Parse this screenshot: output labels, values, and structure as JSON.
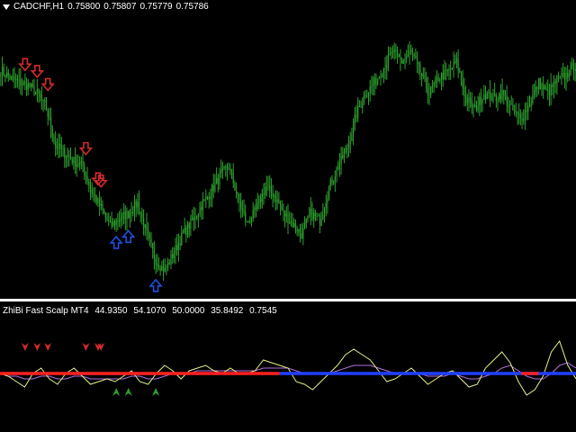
{
  "main_chart": {
    "symbol_tf": "CADCHF,H1",
    "open": "0.75800",
    "high": "0.75807",
    "low": "0.75779",
    "close": "0.75786",
    "candle_color": "#2ea12e",
    "sell_arrow_color": "#d42a2a",
    "buy_arrow_color": "#1f4fe0"
  },
  "indicator": {
    "name": "ZhiBi Fast Scalp MT4",
    "v1": "44.9350",
    "v2": "54.1070",
    "v3": "50.0000",
    "v4": "35.8492",
    "v5": "0.7545",
    "sell_line_color": "#ff2020",
    "buy_line_color": "#2040ff",
    "fast_line_color": "#e6f08a",
    "slow_line_color": "#b070e0"
  },
  "chart_data": {
    "type": "line",
    "series": [
      {
        "values": [
          0.7585,
          0.7582,
          0.758,
          0.7579,
          0.7576,
          0.757,
          0.7556,
          0.7553,
          0.755,
          0.7548,
          0.7538,
          0.7532,
          0.7525,
          0.7528,
          0.753,
          0.7534,
          0.7522,
          0.7512,
          0.7508,
          0.7515,
          0.7522,
          0.7527,
          0.7533,
          0.7538,
          0.7544,
          0.7548,
          0.7536,
          0.7526,
          0.7531,
          0.754,
          0.7537,
          0.753,
          0.7526,
          0.7522,
          0.753,
          0.7527,
          0.754,
          0.7548,
          0.7555,
          0.7568,
          0.7576,
          0.758,
          0.7586,
          0.7592,
          0.7588,
          0.7592,
          0.7584,
          0.7576,
          0.7582,
          0.7584,
          0.7588,
          0.7574,
          0.757,
          0.7576,
          0.7574,
          0.7576,
          0.757,
          0.7566,
          0.7572,
          0.758,
          0.7576,
          0.7581,
          0.7583,
          0.7587
        ]
      }
    ],
    "sell_arrows": [
      16,
      24,
      31,
      56,
      64,
      66
    ],
    "buy_arrows": [
      76,
      84,
      102
    ],
    "indicator_fast": [
      50,
      49,
      47,
      45,
      50,
      52,
      48,
      46,
      50,
      52,
      49,
      46,
      47,
      48,
      47,
      49,
      51,
      47,
      46,
      50,
      53,
      51,
      48,
      51,
      52,
      53,
      51,
      50,
      52,
      50,
      50,
      51,
      55,
      54,
      53,
      52,
      47,
      46,
      44,
      47,
      50,
      53,
      57,
      59,
      57,
      55,
      51,
      47,
      48,
      50,
      52,
      49,
      46,
      48,
      50,
      51,
      48,
      45,
      46,
      52,
      55,
      58,
      54,
      47,
      42,
      44,
      49,
      58,
      62,
      53,
      48
    ],
    "indicator_slow": [
      50,
      49,
      49,
      48,
      48,
      49,
      49,
      48,
      48,
      49,
      49,
      48,
      48,
      48,
      48,
      48,
      49,
      49,
      48,
      48,
      49,
      50,
      50,
      50,
      51,
      51,
      51,
      51,
      51,
      51,
      51,
      51,
      52,
      52,
      52,
      52,
      51,
      50,
      50,
      50,
      50,
      51,
      52,
      53,
      53,
      53,
      52,
      51,
      50,
      50,
      50,
      50,
      49,
      49,
      49,
      50,
      49,
      48,
      48,
      49,
      50,
      52,
      53,
      51,
      49,
      48,
      48,
      50,
      53,
      54,
      52
    ],
    "indicator_signal_split_index": 34
  }
}
